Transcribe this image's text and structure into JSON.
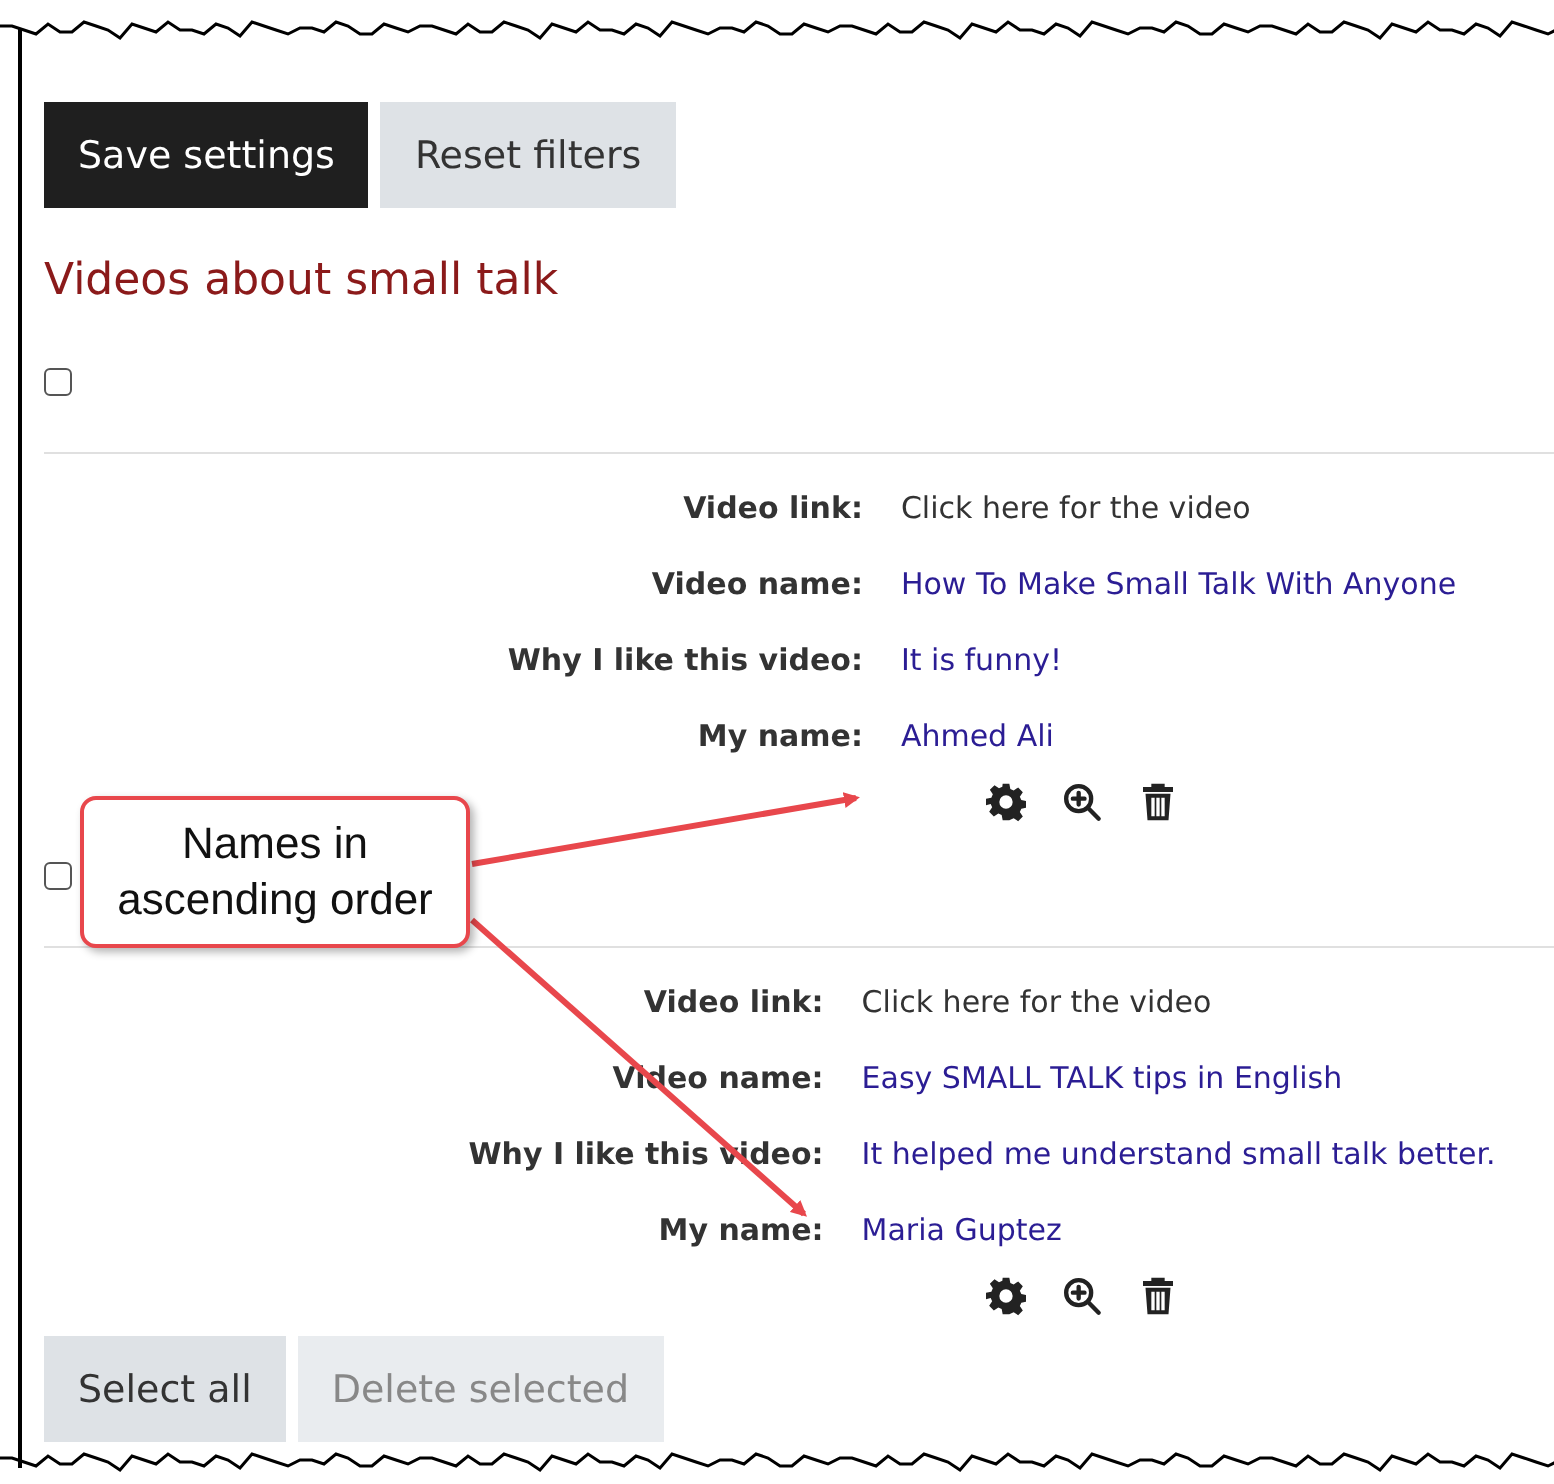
{
  "top_buttons": [
    {
      "label": "Save settings",
      "kind": "primary",
      "disabled": false
    },
    {
      "label": "Reset filters",
      "kind": "secondary",
      "disabled": false
    }
  ],
  "heading": "Videos about small talk",
  "entries": [
    {
      "checked": false,
      "fields": [
        {
          "label": "Video link:",
          "value": "Click here for the video",
          "kind": "text"
        },
        {
          "label": "Video name:",
          "value": "How To Make Small Talk With Anyone",
          "kind": "link"
        },
        {
          "label": "Why I like this video:",
          "value": "It is funny!",
          "kind": "link"
        },
        {
          "label": "My name:",
          "value": "Ahmed Ali",
          "kind": "link"
        }
      ]
    },
    {
      "checked": false,
      "fields": [
        {
          "label": "Video link:",
          "value": "Click here for the video",
          "kind": "text"
        },
        {
          "label": "Video name:",
          "value": "Easy SMALL TALK tips in English",
          "kind": "link"
        },
        {
          "label": "Why I like this video:",
          "value": "It helped me understand small talk better.",
          "kind": "link"
        },
        {
          "label": "My name:",
          "value": "Maria Guptez",
          "kind": "link"
        }
      ]
    }
  ],
  "bottom_buttons": [
    {
      "label": "Select all",
      "kind": "secondary",
      "disabled": false
    },
    {
      "label": "Delete selected",
      "kind": "secondary",
      "disabled": true
    }
  ],
  "callout": {
    "text": "Names in ascending order"
  }
}
